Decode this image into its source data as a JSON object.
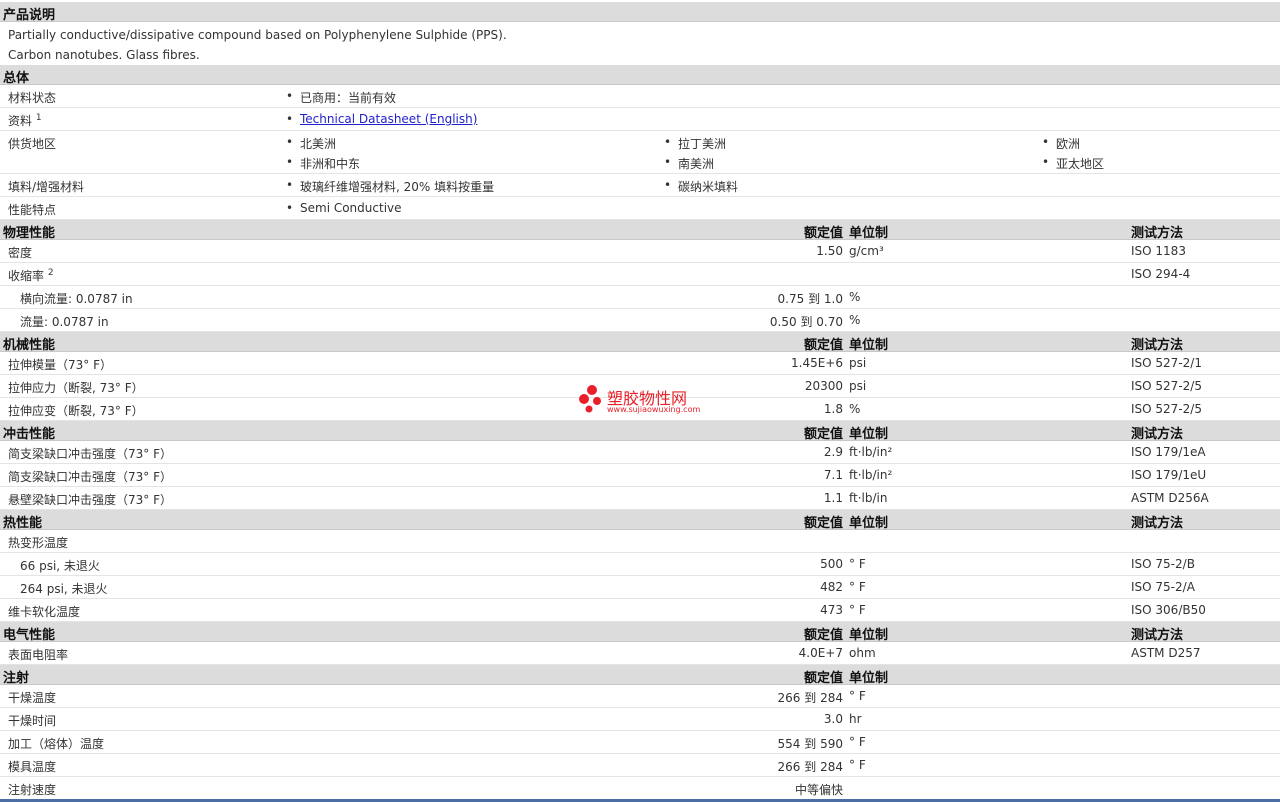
{
  "description": {
    "title": "产品说明",
    "lines": [
      "Partially conductive/dissipative compound based on Polyphenylene Sulphide (PPS).",
      "Carbon nanotubes. Glass fibres."
    ]
  },
  "general": {
    "title": "总体",
    "material_status": {
      "label": "材料状态",
      "value": "已商用：当前有效"
    },
    "info": {
      "label": "资料",
      "sup": "1",
      "link": "Technical Datasheet (English)"
    },
    "supply": {
      "label": "供货地区",
      "regions": [
        "北美洲",
        "拉丁美洲",
        "欧洲",
        "非洲和中东",
        "南美洲",
        "亚太地区"
      ]
    },
    "filler": {
      "label": "填料/增强材料",
      "items": [
        "玻璃纤维增强材料, 20% 填料按重量",
        "碳纳米填料"
      ]
    },
    "features": {
      "label": "性能特点",
      "value": "Semi Conductive"
    }
  },
  "columns": {
    "nominal": "额定值",
    "unit": "单位制",
    "method": "测试方法"
  },
  "physical": {
    "title": "物理性能",
    "rows": [
      {
        "label": "密度",
        "value": "1.50",
        "unit": "g/cm³",
        "method": "ISO 1183"
      },
      {
        "label": "收缩率",
        "sup": "2",
        "method": "ISO 294-4"
      },
      {
        "label": "横向流量: 0.0787 in",
        "lo": "0.75",
        "to": "到",
        "hi": "1.0",
        "unit": "%"
      },
      {
        "label": "流量: 0.0787 in",
        "lo": "0.50",
        "to": "到",
        "hi": "0.70",
        "unit": "%"
      }
    ]
  },
  "mechanical": {
    "title": "机械性能",
    "rows": [
      {
        "label": "拉伸模量（73° F）",
        "value": "1.45E+6",
        "unit": "psi",
        "method": "ISO 527-2/1"
      },
      {
        "label": "拉伸应力（断裂, 73° F）",
        "value": "20300",
        "unit": "psi",
        "method": "ISO 527-2/5"
      },
      {
        "label": "拉伸应变（断裂, 73° F）",
        "value": "1.8",
        "unit": "%",
        "method": "ISO 527-2/5"
      }
    ]
  },
  "impact": {
    "title": "冲击性能",
    "rows": [
      {
        "label": "简支梁缺口冲击强度（73° F）",
        "value": "2.9",
        "unit": "ft·lb/in²",
        "method": "ISO 179/1eA"
      },
      {
        "label": "简支梁缺口冲击强度（73° F）",
        "value": "7.1",
        "unit": "ft·lb/in²",
        "method": "ISO 179/1eU"
      },
      {
        "label": "悬壁梁缺口冲击强度（73° F）",
        "value": "1.1",
        "unit": "ft·lb/in",
        "method": "ASTM D256A"
      }
    ]
  },
  "thermal": {
    "title": "热性能",
    "rows": [
      {
        "label": "热变形温度"
      },
      {
        "label": "66 psi, 未退火",
        "value": "500",
        "unit": "° F",
        "method": "ISO 75-2/B"
      },
      {
        "label": "264 psi, 未退火",
        "value": "482",
        "unit": "° F",
        "method": "ISO 75-2/A"
      },
      {
        "label": "维卡软化温度",
        "value": "473",
        "unit": "° F",
        "method": "ISO 306/B50"
      }
    ]
  },
  "electrical": {
    "title": "电气性能",
    "rows": [
      {
        "label": "表面电阻率",
        "value": "4.0E+7",
        "unit": "ohm",
        "method": "ASTM D257"
      }
    ]
  },
  "injection": {
    "title": "注射",
    "rows": [
      {
        "label": "干燥温度",
        "lo": "266",
        "to": "到",
        "hi": "284",
        "unit": "° F"
      },
      {
        "label": "干燥时间",
        "value": "3.0",
        "unit": "hr"
      },
      {
        "label": "加工（熔体）温度",
        "lo": "554",
        "to": "到",
        "hi": "590",
        "unit": "° F"
      },
      {
        "label": "模具温度",
        "lo": "266",
        "to": "到",
        "hi": "284",
        "unit": "° F"
      },
      {
        "label": "注射速度",
        "value": "中等偏快"
      }
    ]
  },
  "watermark": {
    "name": "塑胶物性网",
    "url": "www.sujiaowuxing.com",
    "color": "#e8202a"
  }
}
